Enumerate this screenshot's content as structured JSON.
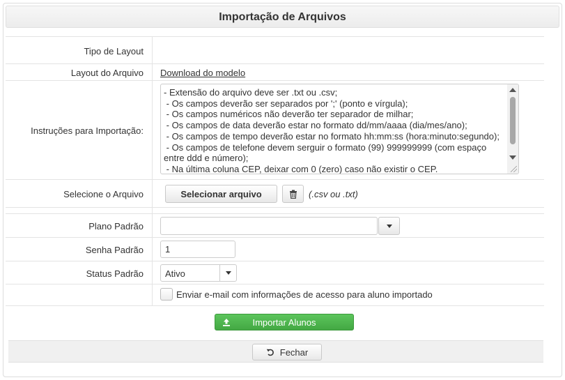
{
  "dialog": {
    "title": "Importação de Arquivos"
  },
  "form": {
    "tipo_layout": {
      "label": "Tipo de Layout",
      "value": ""
    },
    "layout_arquivo": {
      "label": "Layout do Arquivo",
      "link": "Download do modelo"
    },
    "instrucoes": {
      "label": "Instruções para Importação:",
      "text": "- Extensão do arquivo deve ser .txt ou .csv;\n - Os campos deverão ser separados por ';' (ponto e vírgula);\n - Os campos numéricos não deverão ter separador de milhar;\n - Os campos de data deverão estar no formato dd/mm/aaaa (dia/mes/ano);\n - Os campos de tempo deverão estar no formato hh:mm:ss (hora:minuto:segundo);\n - Os campos de telefone devem serguir o formato (99) 999999999 (com espaço entre ddd e número);\n - Na última coluna CEP, deixar com 0 (zero) caso não existir o CEP."
    },
    "arquivo": {
      "label": "Selecione o Arquivo",
      "button": "Selecionar arquivo",
      "hint": "(.csv ou .txt)",
      "trash_icon": "trash-icon"
    },
    "plano": {
      "label": "Plano Padrão",
      "value": ""
    },
    "senha": {
      "label": "Senha Padrão",
      "value": "1"
    },
    "status": {
      "label": "Status Padrão",
      "value": "Ativo"
    },
    "email": {
      "label": "Enviar e-mail com informações de acesso para aluno importado",
      "checked": false
    }
  },
  "actions": {
    "importar": {
      "label": "Importar Alunos",
      "icon": "upload-icon",
      "color": "#4cb84c"
    },
    "fechar": {
      "label": "Fechar",
      "icon": "undo-icon"
    }
  }
}
